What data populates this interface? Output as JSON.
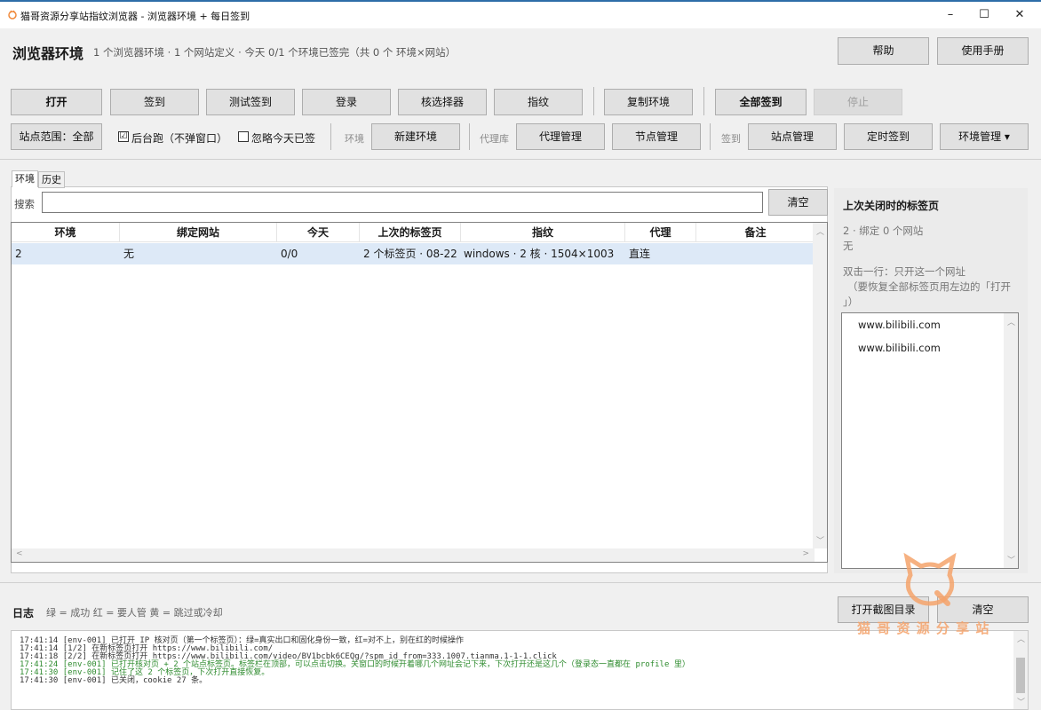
{
  "window": {
    "title": "猫哥资源分享站指纹浏览器 - 浏览器环境 + 每日签到",
    "controls": {
      "minimize": "–",
      "maximize": "☐",
      "close": "✕"
    }
  },
  "header": {
    "title": "浏览器环境",
    "subtitle": "1 个浏览器环境 · 1 个网站定义 · 今天 0/1 个环境已签完（共 0 个 环境×网站）",
    "help": "帮助",
    "manual": "使用手册"
  },
  "toolbar1": {
    "open": "打开",
    "checkin": "签到",
    "test_checkin": "测试签到",
    "login": "登录",
    "selector": "核选择器",
    "fingerprint": "指纹",
    "copy_env": "复制环境",
    "checkin_all": "全部签到",
    "stop": "停止"
  },
  "toolbar2": {
    "site_scope": "站点范围：全部",
    "background_run": "后台跑（不弹窗口）",
    "background_checked": "☑",
    "ignore_today": "忽略今天已签",
    "env_label": "环境",
    "new_env": "新建环境",
    "proxy_lib_label": "代理库",
    "proxy_manage": "代理管理",
    "node_manage": "节点管理",
    "checkin_label": "签到",
    "site_manage": "站点管理",
    "scheduled_checkin": "定时签到",
    "env_manage": "环境管理 ▾"
  },
  "tabs": [
    "环境",
    "历史"
  ],
  "search": {
    "label": "搜索",
    "value": "",
    "clear": "清空"
  },
  "table": {
    "columns": [
      "环境",
      "绑定网站",
      "今天",
      "上次的标签页",
      "指纹",
      "代理",
      "备注"
    ],
    "rows": [
      [
        "2",
        "无",
        "0/0",
        "2 个标签页 · 08-22",
        "windows · 2 核 · 1504×1003",
        "直连",
        ""
      ]
    ]
  },
  "side": {
    "title": "上次关闭时的标签页",
    "line1": "2 · 绑定 0 个网站",
    "line2": "无",
    "hint1": "双击一行：只开这一个网址",
    "hint2": "（要恢复全部标签页用左边的「打开",
    "hint3": "」）",
    "urls": [
      "www.bilibili.com",
      "www.bilibili.com"
    ]
  },
  "log": {
    "title": "日志",
    "legend": "绿 = 成功   红 = 要人管   黄 = 跳过或冷却",
    "open_screenshot_dir": "打开截图目录",
    "clear": "清空",
    "lines": [
      {
        "text": "17:41:14 [env-001] 已打开 IP 核对页（第一个标签页）：绿=真实出口和固化身份一致，红=对不上，别在红的时候操作",
        "color": "#333333"
      },
      {
        "text": "17:41:14   [1/2] 在新标签页打开 https://www.bilibili.com/",
        "color": "#333333"
      },
      {
        "text": "17:41:18   [2/2] 在新标签页打开 https://www.bilibili.com/video/BV1bcbk6CEQg/?spm_id_from=333.1007.tianma.1-1-1.click",
        "color": "#333333"
      },
      {
        "text": "17:41:24 [env-001] 已打开核对页 + 2 个站点标签页。标签栏在顶部，可以点击切换。关窗口的时候开着哪几个网址会记下来，下次打开还是这几个（登录态一直都在 profile 里）",
        "color": "#2e8b2e"
      },
      {
        "text": "17:41:30 [env-001] 记住了这 2 个标签页，下次打开直接恢复。",
        "color": "#2e8b2e"
      },
      {
        "text": "17:41:30 [env-001] 已关闭，cookie 27 条。",
        "color": "#333333"
      }
    ]
  },
  "watermark": {
    "text": "猫 哥 资 源 分 享 站",
    "color": "#f5a36b"
  }
}
